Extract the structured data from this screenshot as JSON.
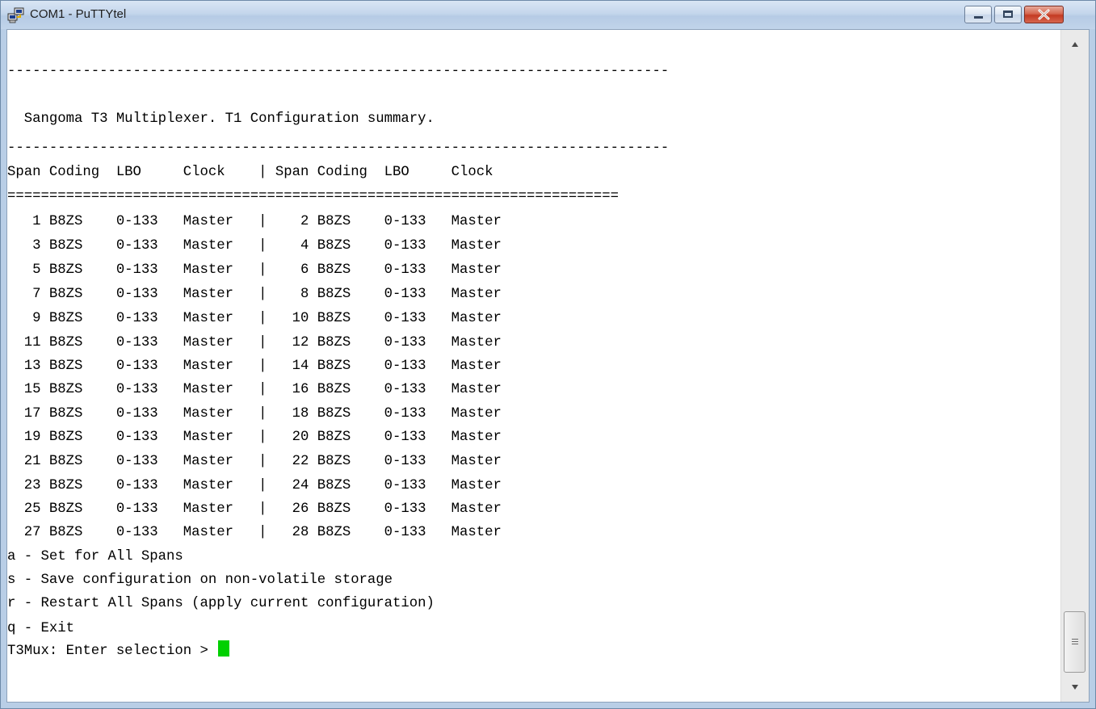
{
  "window": {
    "title": "COM1 - PuTTYtel",
    "icon": "putty-computers-icon",
    "controls": {
      "minimize_icon": "minimize-icon",
      "maximize_icon": "maximize-icon",
      "close_icon": "close-icon"
    },
    "colors": {
      "close": "#c43a22",
      "cursor": "#00d000"
    }
  },
  "terminal": {
    "lines": [
      "",
      "-------------------------------------------------------------------------------",
      "  Sangoma T3 Multiplexer. T1 Configuration summary.",
      "-------------------------------------------------------------------------------",
      "Span Coding  LBO     Clock    | Span Coding  LBO     Clock",
      "=========================================================================",
      "   1 B8ZS    0-133   Master   |    2 B8ZS    0-133   Master",
      "   3 B8ZS    0-133   Master   |    4 B8ZS    0-133   Master",
      "   5 B8ZS    0-133   Master   |    6 B8ZS    0-133   Master",
      "   7 B8ZS    0-133   Master   |    8 B8ZS    0-133   Master",
      "   9 B8ZS    0-133   Master   |   10 B8ZS    0-133   Master",
      "  11 B8ZS    0-133   Master   |   12 B8ZS    0-133   Master",
      "  13 B8ZS    0-133   Master   |   14 B8ZS    0-133   Master",
      "  15 B8ZS    0-133   Master   |   16 B8ZS    0-133   Master",
      "  17 B8ZS    0-133   Master   |   18 B8ZS    0-133   Master",
      "  19 B8ZS    0-133   Master   |   20 B8ZS    0-133   Master",
      "  21 B8ZS    0-133   Master   |   22 B8ZS    0-133   Master",
      "  23 B8ZS    0-133   Master   |   24 B8ZS    0-133   Master",
      "  25 B8ZS    0-133   Master   |   26 B8ZS    0-133   Master",
      "  27 B8ZS    0-133   Master   |   28 B8ZS    0-133   Master",
      "a - Set for All Spans",
      "s - Save configuration on non-volatile storage",
      "r - Restart All Spans (apply current configuration)",
      "q - Exit"
    ],
    "prompt": "T3Mux: Enter selection > "
  },
  "scrollbar": {
    "up_icon": "scroll-up-arrow-icon",
    "down_icon": "scroll-down-arrow-icon",
    "thumb_icon": "scroll-thumb-grip-icon"
  }
}
